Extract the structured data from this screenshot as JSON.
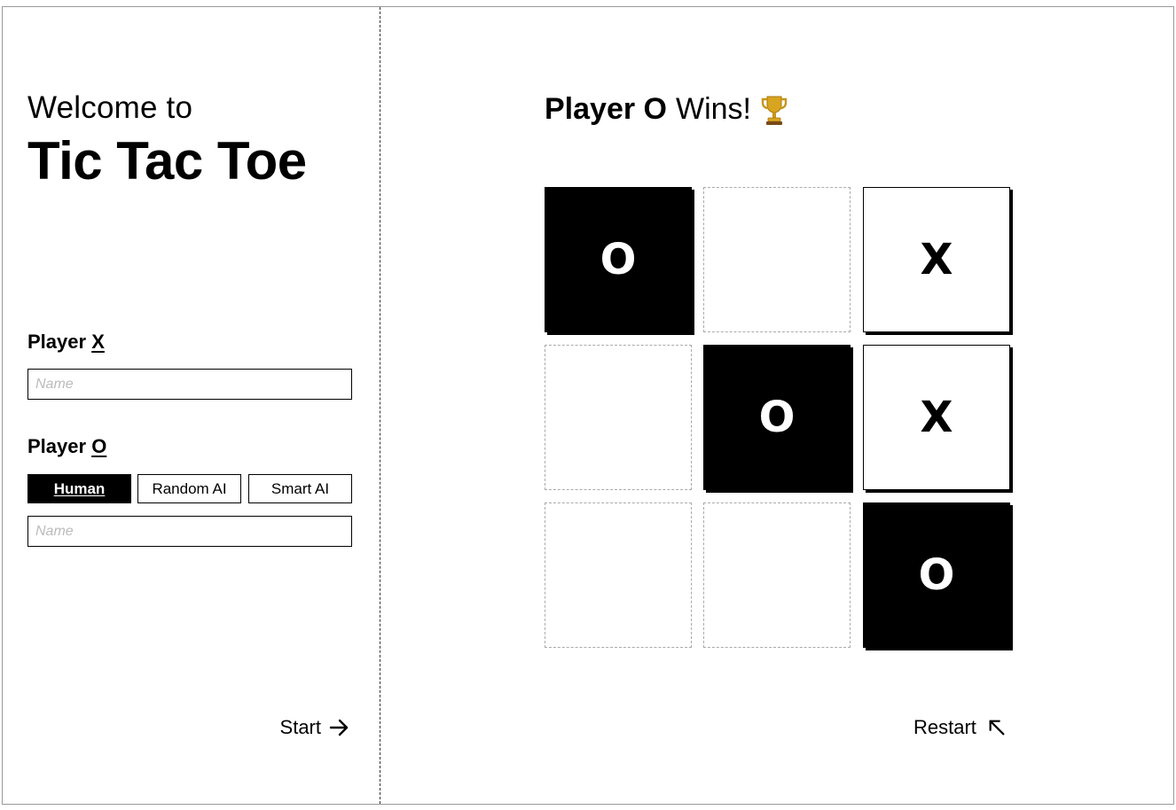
{
  "setup": {
    "welcome": "Welcome to",
    "title": "Tic Tac Toe",
    "player_x": {
      "label": "Player",
      "mark": "X",
      "name_placeholder": "Name"
    },
    "player_o": {
      "label": "Player",
      "mark": "O",
      "name_placeholder": "Name",
      "modes": [
        "Human",
        "Random AI",
        "Smart AI"
      ],
      "selected_mode": "Human"
    },
    "start_label": "Start",
    "start_icon": "arrow-right-icon"
  },
  "game": {
    "status": {
      "player": "Player O",
      "text": "Wins!",
      "icon": "trophy-icon"
    },
    "board": [
      "O",
      "",
      "X",
      "",
      "O",
      "X",
      "",
      "",
      "O"
    ],
    "restart_label": "Restart",
    "restart_icon": "arrow-up-left-icon"
  }
}
